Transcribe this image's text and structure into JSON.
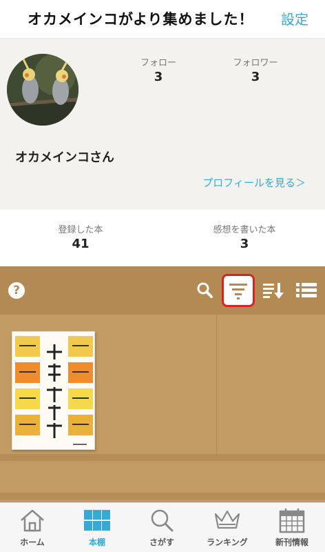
{
  "header": {
    "title": "オカメインコがより集めました！",
    "settings_label": "設定"
  },
  "profile": {
    "avatar_icon": "cockatiel-avatar",
    "follow_label": "フォロー",
    "follow_count": "3",
    "follower_label": "フォロワー",
    "follower_count": "3",
    "username": "オカメインコさん",
    "view_profile_label": "プロフィールを見る＞"
  },
  "counts": {
    "registered_label": "登録した本",
    "registered_count": "41",
    "reviewed_label": "感想を書いた本",
    "reviewed_count": "3"
  },
  "toolbar": {
    "help_label": "?",
    "icons": [
      "help-icon",
      "search-icon",
      "filter-icon",
      "sort-icon",
      "list-view-icon"
    ]
  },
  "shelf": {
    "books": [
      {
        "cover_icon": "book-cover"
      }
    ]
  },
  "tabbar": {
    "tabs": [
      {
        "label": "ホーム",
        "icon": "home-icon"
      },
      {
        "label": "本棚",
        "icon": "bookshelf-icon",
        "active": true
      },
      {
        "label": "さがす",
        "icon": "search-icon"
      },
      {
        "label": "ランキング",
        "icon": "crown-icon"
      },
      {
        "label": "新刊情報",
        "icon": "calendar-icon"
      }
    ]
  },
  "colors": {
    "accent": "#35a9d8",
    "shelf": "#c29a64",
    "toolbar": "#b48a54",
    "highlight": "#e0201c"
  }
}
